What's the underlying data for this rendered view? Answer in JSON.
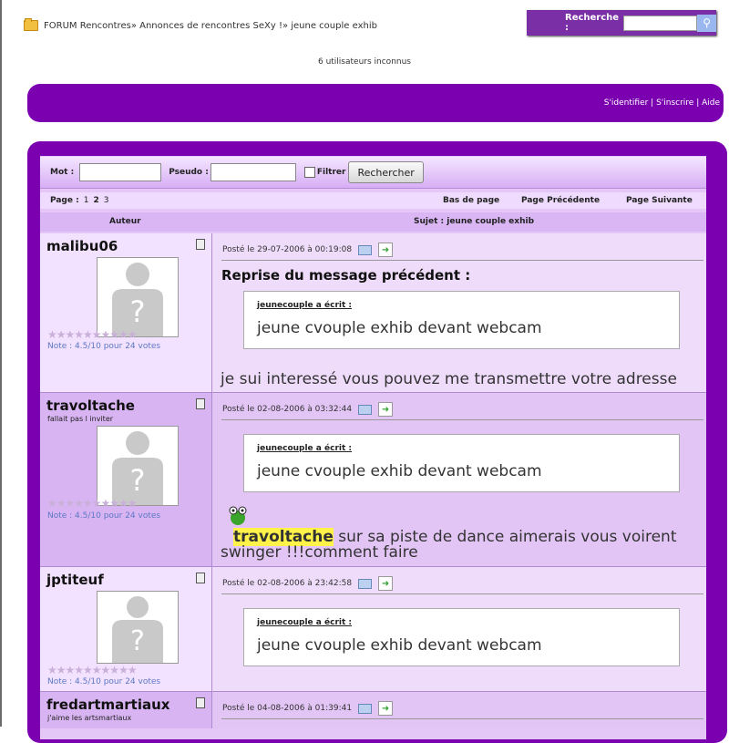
{
  "breadcrumb": "FORUM Rencontres» Annonces de rencontres SeXy !» jeune couple exhib",
  "search": {
    "label": "Recherche :",
    "value": ""
  },
  "online": "6 utilisateurs inconnus",
  "auth_links": "S'identifier | S'inscrire | Aide",
  "filters": {
    "mot_label": "Mot :",
    "pseudo_label": "Pseudo :",
    "filtrer_label": "Filtrer",
    "button_label": "Rechercher",
    "mot_value": "",
    "pseudo_value": ""
  },
  "pagination": {
    "label": "Page :",
    "pages": [
      "1",
      "2",
      "3"
    ],
    "bottom": "Bas de page",
    "prev": "Page Précédente",
    "next": "Page Suivante"
  },
  "header": {
    "author": "Auteur",
    "subject": "Sujet : jeune couple exhib"
  },
  "posts": [
    {
      "author": "malibu06",
      "subtitle": "",
      "note": "Note : 4.5/10 pour 24 votes",
      "date": "Posté le 29-07-2006 à 00:19:08",
      "heading": "Reprise du message précédent :",
      "quote_author": "jeunecouple a écrit :",
      "quote_text": "jeune cvouple exhib devant webcam",
      "body": "je sui interessé vous pouvez me transmettre votre adresse msn"
    },
    {
      "author": "travoltache",
      "subtitle": "fallait pas l inviter",
      "note": "Note : 4.5/10 pour 24 votes",
      "date": "Posté le 02-08-2006 à 03:32:44",
      "quote_author": "jeunecouple a écrit :",
      "quote_text": "jeune cvouple exhib devant webcam",
      "body_highlight": "travoltache",
      "body_rest": " sur sa piste de dance aimerais vous voirent",
      "body_line2": "swinger !!!comment faire"
    },
    {
      "author": "jptiteuf",
      "subtitle": "",
      "note": "Note : 4.5/10 pour 24 votes",
      "date": "Posté le 02-08-2006 à 23:42:58",
      "quote_author": "jeunecouple a écrit :",
      "quote_text": "jeune cvouple exhib devant webcam"
    },
    {
      "author": "fredartmartiaux",
      "subtitle": "j'aime les artsmartiaux",
      "date": "Posté le 04-08-2006 à 01:39:41"
    }
  ],
  "stars": "★★★★★★★★★★"
}
